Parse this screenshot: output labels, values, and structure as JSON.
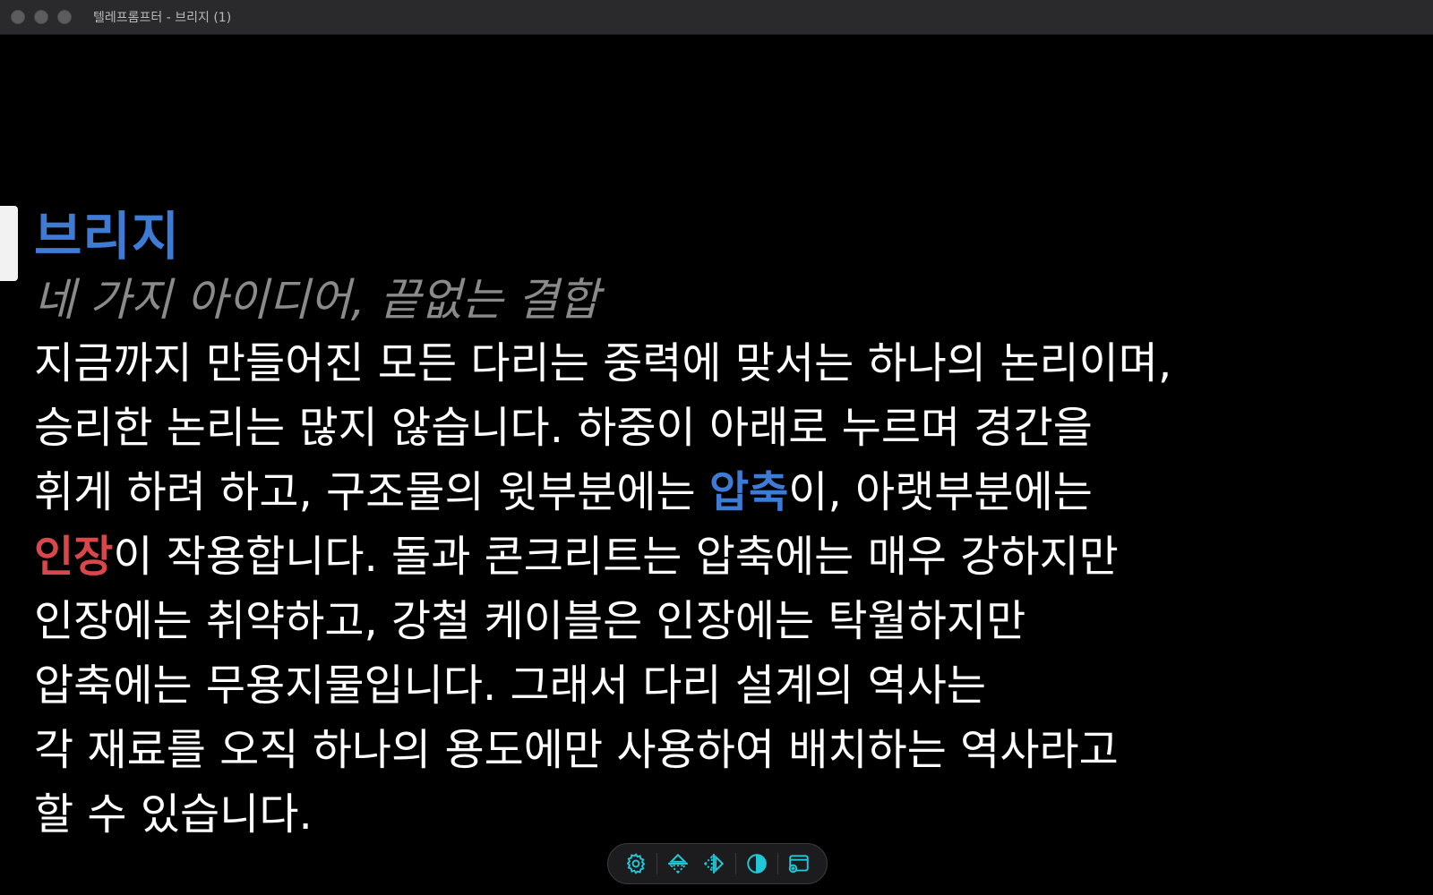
{
  "window": {
    "title": "텔레프롬프터 - 브리지 (1)"
  },
  "colors": {
    "accent_blue": "#3d7bd4",
    "accent_red": "#d9474a",
    "subtitle_gray": "#8a8a8a",
    "icon_cyan": "#22c7d6"
  },
  "script": {
    "heading": "브리지",
    "subtitle": "네 가지 아이디어, 끝없는 결합",
    "lines": [
      {
        "parts": [
          {
            "text": "지금까지 만들어진 모든 다리는 중력에 맞서는 하나의 논리이며,"
          }
        ]
      },
      {
        "parts": [
          {
            "text": "승리한 논리는 많지 않습니다. 하중이 아래로 누르며 경간을"
          }
        ]
      },
      {
        "parts": [
          {
            "text": "휘게 하려 하고, 구조물의 윗부분에는 "
          },
          {
            "text": "압축",
            "style": "blue"
          },
          {
            "text": "이, 아랫부분에는"
          }
        ]
      },
      {
        "parts": [
          {
            "text": "인장",
            "style": "red"
          },
          {
            "text": "이 작용합니다. 돌과 콘크리트는 압축에는 매우 강하지만"
          }
        ]
      },
      {
        "parts": [
          {
            "text": "인장에는 취약하고, 강철 케이블은 인장에는 탁월하지만"
          }
        ]
      },
      {
        "parts": [
          {
            "text": "압축에는 무용지물입니다. 그래서 다리 설계의 역사는"
          }
        ]
      },
      {
        "parts": [
          {
            "text": "각 재료를 오직 하나의 용도에만 사용하여 배치하는 역사라고"
          }
        ]
      },
      {
        "parts": [
          {
            "text": "할 수 있습니다."
          }
        ]
      }
    ]
  },
  "toolbar": {
    "buttons": [
      {
        "name": "settings-button",
        "icon": "gear-icon"
      },
      {
        "name": "flip-vertical-button",
        "icon": "flip-vertical-icon"
      },
      {
        "name": "flip-horizontal-button",
        "icon": "flip-horizontal-icon"
      },
      {
        "name": "contrast-button",
        "icon": "contrast-icon"
      },
      {
        "name": "add-window-button",
        "icon": "add-window-icon"
      }
    ]
  }
}
